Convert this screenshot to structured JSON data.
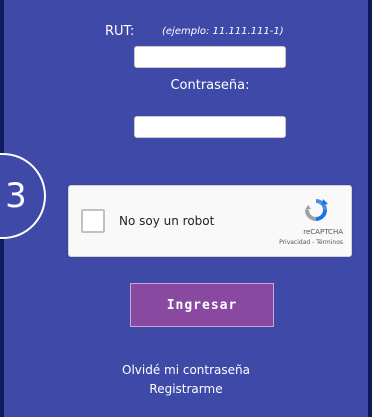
{
  "form": {
    "rut_label": "RUT:",
    "rut_example": "(ejemplo: 11.111.111-1)",
    "rut_value": "",
    "password_label": "Contraseña:",
    "password_value": ""
  },
  "step_badge": "3",
  "captcha": {
    "label": "No soy un robot",
    "brand": "reCAPTCHA",
    "privacy_link": "Privacidad",
    "separator": " - ",
    "terms_link": "Términos",
    "logo_icon": "recaptcha-logo-icon"
  },
  "actions": {
    "submit_label": "Ingresar",
    "forgot_password": "Olvidé mi contraseña",
    "register": "Registrarme"
  },
  "colors": {
    "page_background": "#0e1a5a",
    "panel_background": "#3f4aa8",
    "submit_button": "#8a49a0"
  }
}
